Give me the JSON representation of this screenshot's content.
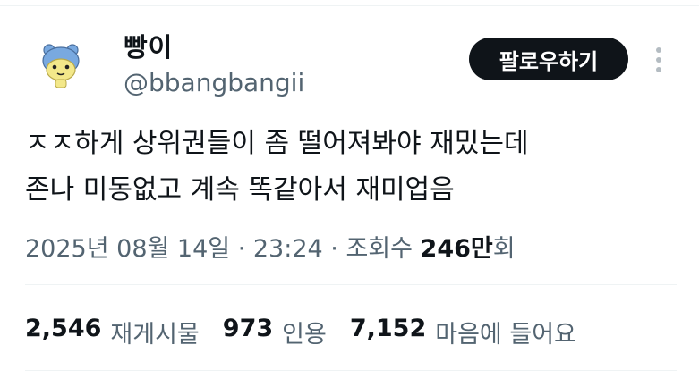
{
  "author": {
    "name": "빵이",
    "handle": "@bbangbangii",
    "avatar_icon": "bear-avatar-icon"
  },
  "follow_button": {
    "label": "팔로우하기"
  },
  "more_icon": "more-vertical-icon",
  "tweet": {
    "lines": [
      "ㅈㅈ하게 상위권들이 좀 떨어져봐야 재밌는데",
      "존나 미동없고 계속 똑같아서 재미업음"
    ]
  },
  "meta": {
    "date": "2025년 08월 14일",
    "dot1": " · ",
    "time": "23:24",
    "dot2": " · ",
    "views_label": "조회수 ",
    "views_count": "246만",
    "views_unit": "회"
  },
  "stats": [
    {
      "count": "2,546",
      "label": "재게시물"
    },
    {
      "count": "973",
      "label": "인용"
    },
    {
      "count": "7,152",
      "label": "마음에 들어요"
    }
  ],
  "colors": {
    "text": "#0f1419",
    "secondary": "#536471",
    "divider": "#eff3f4",
    "button_bg": "#0f1419",
    "button_text": "#ffffff",
    "avatar_blue": "#79a9e0",
    "avatar_yellow": "#f3e88a"
  }
}
